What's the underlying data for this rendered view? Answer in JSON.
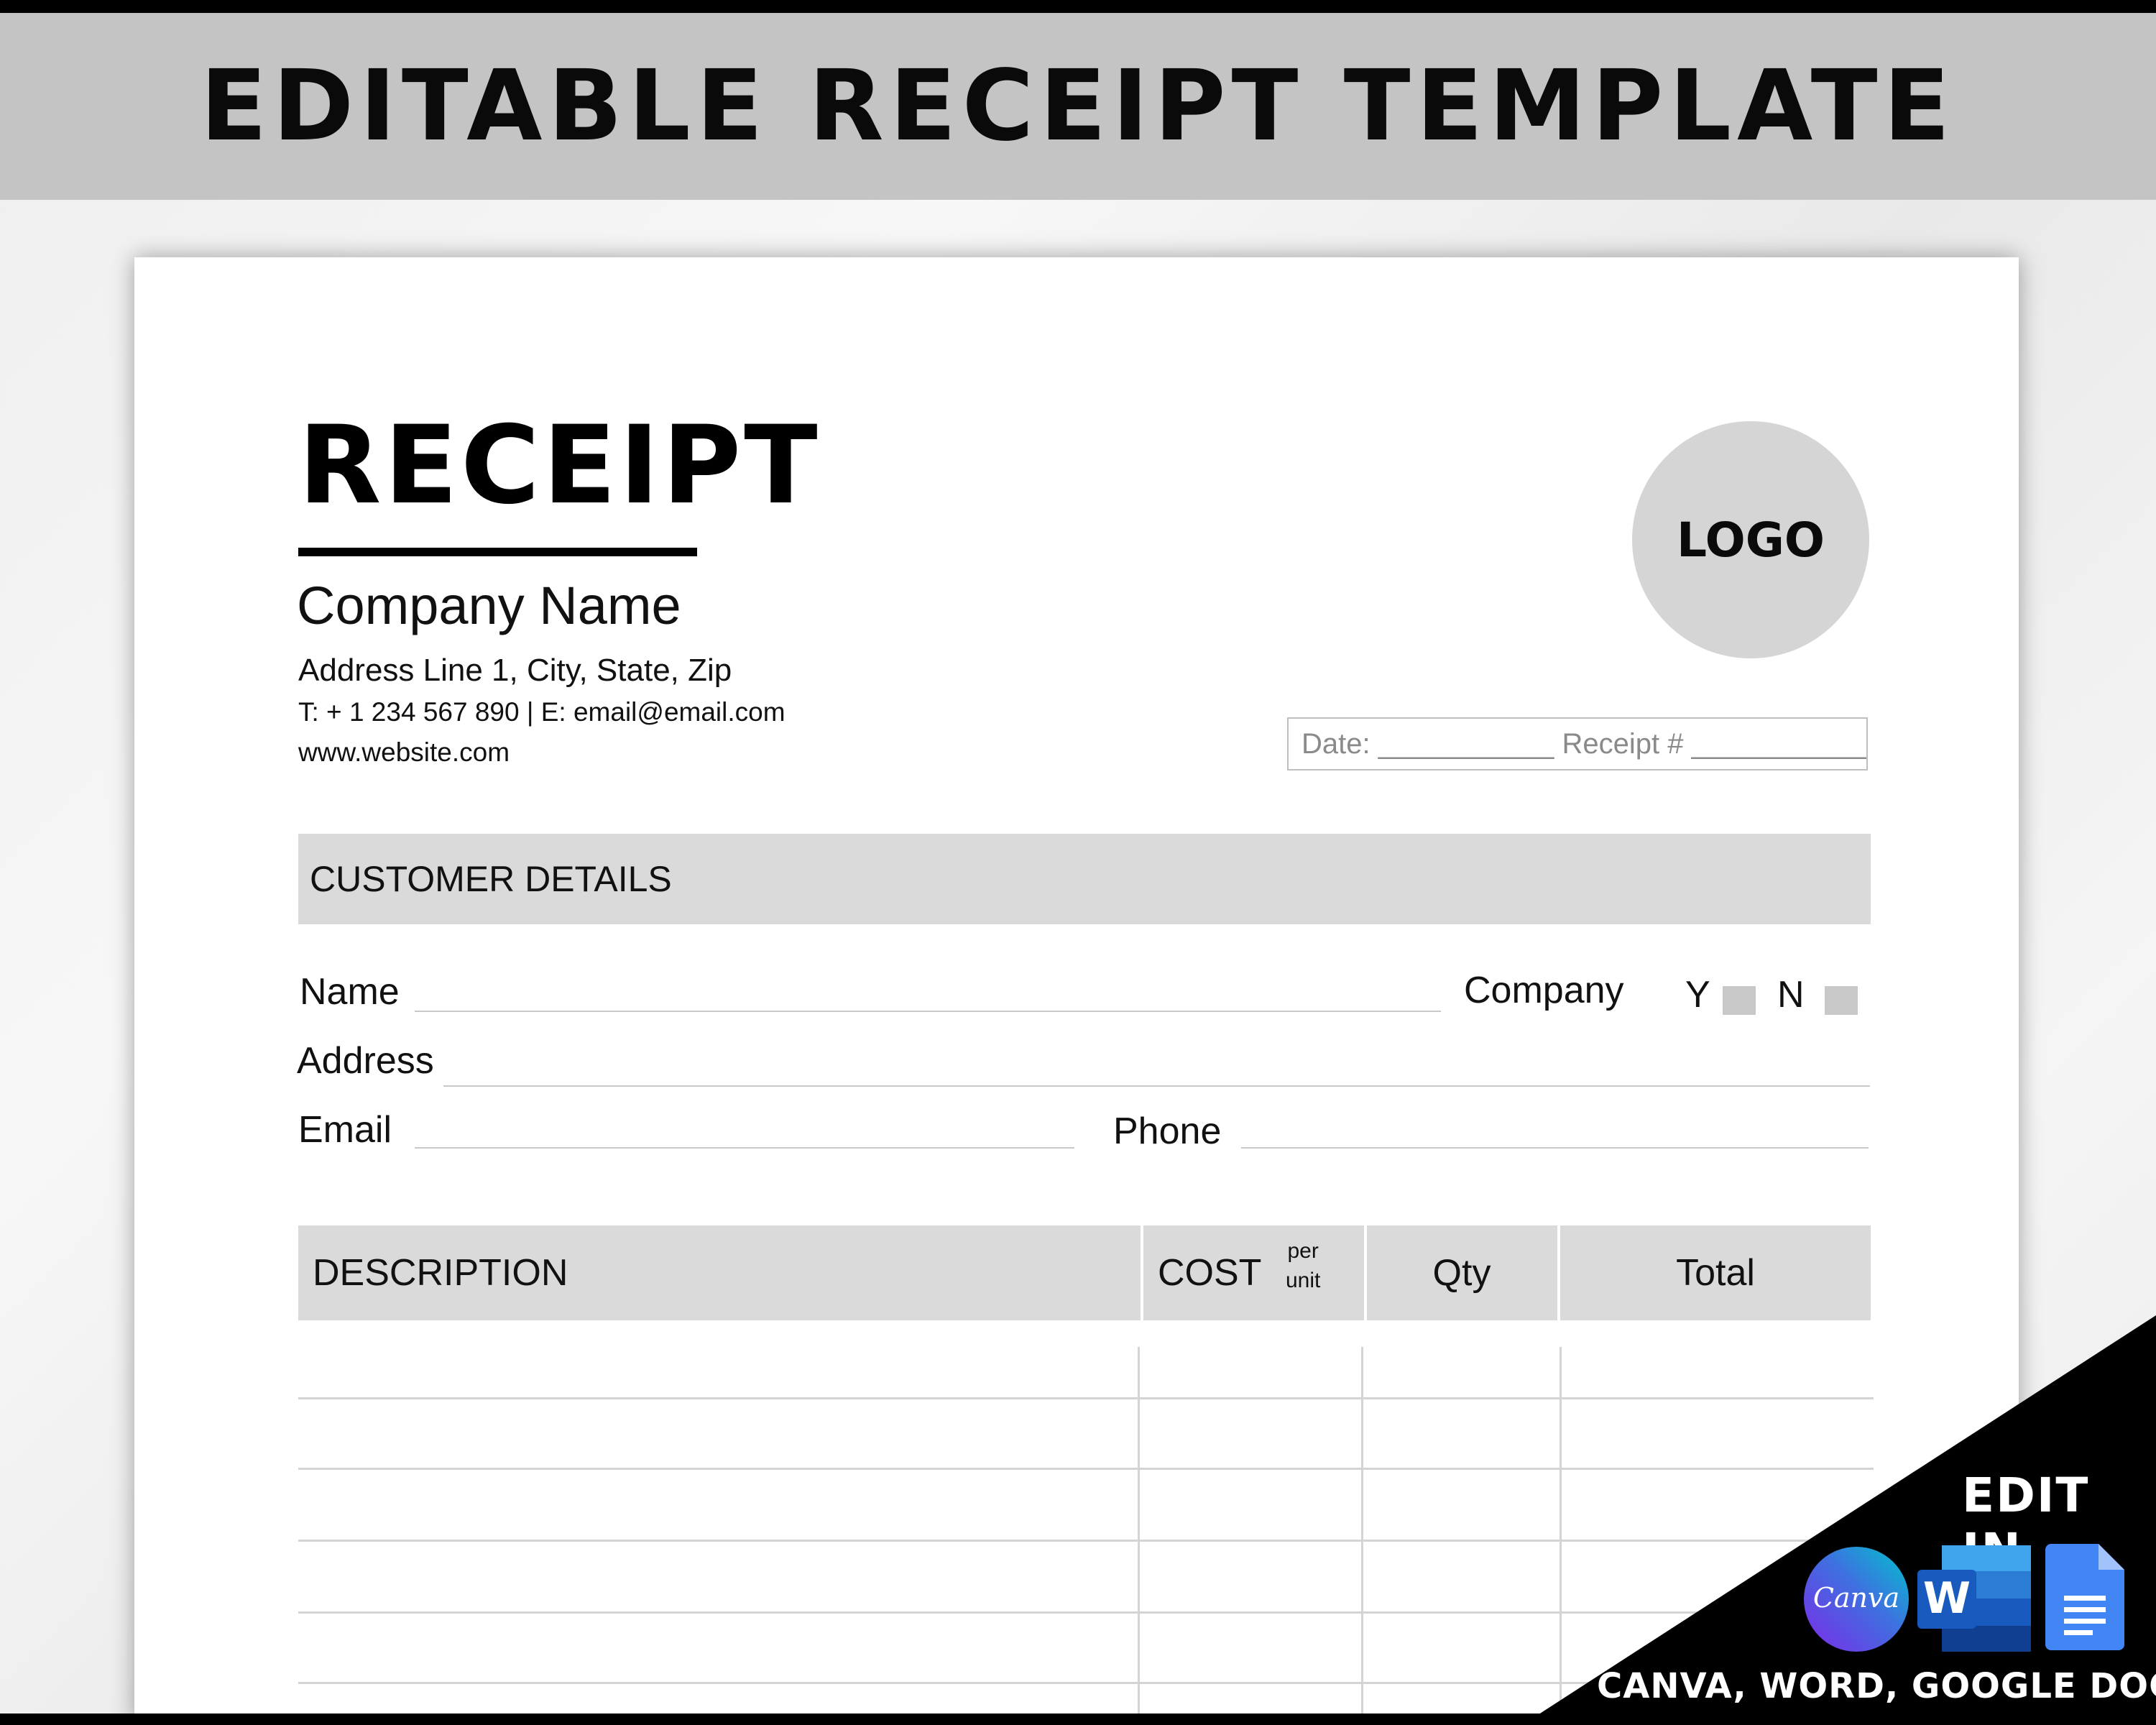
{
  "banner": {
    "title": "EDITABLE RECEIPT TEMPLATE"
  },
  "receipt": {
    "title": "RECEIPT",
    "company_name": "Company Name",
    "address": "Address Line 1, City, State, Zip",
    "contact": "T: + 1 234 567 890 |  E: email@email.com",
    "website": "www.website.com",
    "logo_label": "LOGO",
    "date_receipt": "Date: ___________ Receipt # ___________"
  },
  "customer": {
    "section_label": "CUSTOMER DETAILS",
    "name_label": "Name",
    "company_label": "Company",
    "yes_label": "Y",
    "no_label": "N",
    "address_label": "Address",
    "email_label": "Email",
    "phone_label": "Phone"
  },
  "table": {
    "description_header": "DESCRIPTION",
    "cost_header": "COST",
    "cost_sub_1": "per",
    "cost_sub_2": "unit",
    "qty_header": "Qty",
    "total_header": "Total"
  },
  "promo": {
    "edit_in": "EDIT IN",
    "apps": "CANVA, WORD, GOOGLE DOCS",
    "canva_label": "Canva",
    "word_label": "W",
    "icons": [
      "canva-icon",
      "word-icon",
      "google-docs-icon"
    ]
  },
  "colors": {
    "banner_bg": "#c4c4c4",
    "section_bg": "#dadada",
    "logo_bg": "#d5d5d5",
    "canva_purple": "#7d2ae8",
    "canva_teal": "#00c4cc",
    "word_blue": "#185abd",
    "docs_blue": "#4285f4"
  }
}
